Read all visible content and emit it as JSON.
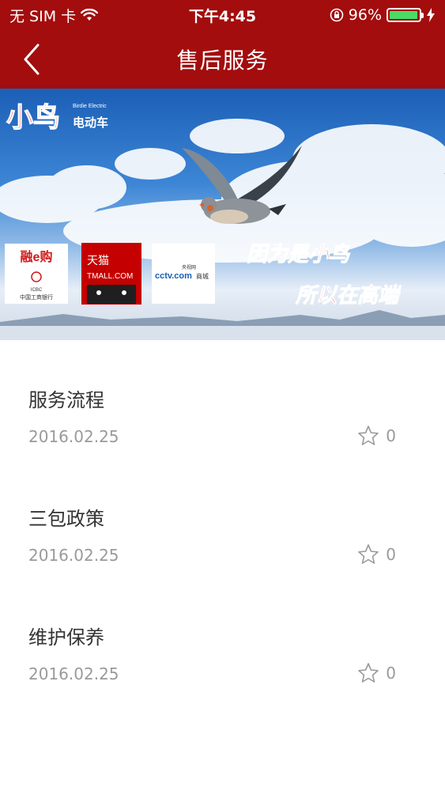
{
  "status_bar": {
    "carrier": "无 SIM 卡",
    "time": "下午4:45",
    "battery": "96%",
    "battery_level": 0.96
  },
  "nav": {
    "title": "售后服务"
  },
  "banner": {
    "brand_main": "小鸟",
    "brand_sub": "电动车",
    "brand_en": "Birdie Electric",
    "partner_1_name": "融e购",
    "partner_1_sub": "中国工商银行",
    "partner_1_code": "ICBC",
    "partner_2_name": "天猫",
    "partner_2_en": "TMALL.COM",
    "partner_3_name": "央视网",
    "partner_3_en": "cctv.com",
    "partner_3_sub": "商城",
    "slogan_1": "因为是小鸟",
    "slogan_2": "所以在高端"
  },
  "list": {
    "items": [
      {
        "title": "服务流程",
        "date": "2016.02.25",
        "favorites": "0"
      },
      {
        "title": "三包政策",
        "date": "2016.02.25",
        "favorites": "0"
      },
      {
        "title": "维护保养",
        "date": "2016.02.25",
        "favorites": "0"
      }
    ]
  },
  "colors": {
    "brand_red": "#a30d0d",
    "text": "#333333",
    "muted": "#9a9a9a"
  }
}
